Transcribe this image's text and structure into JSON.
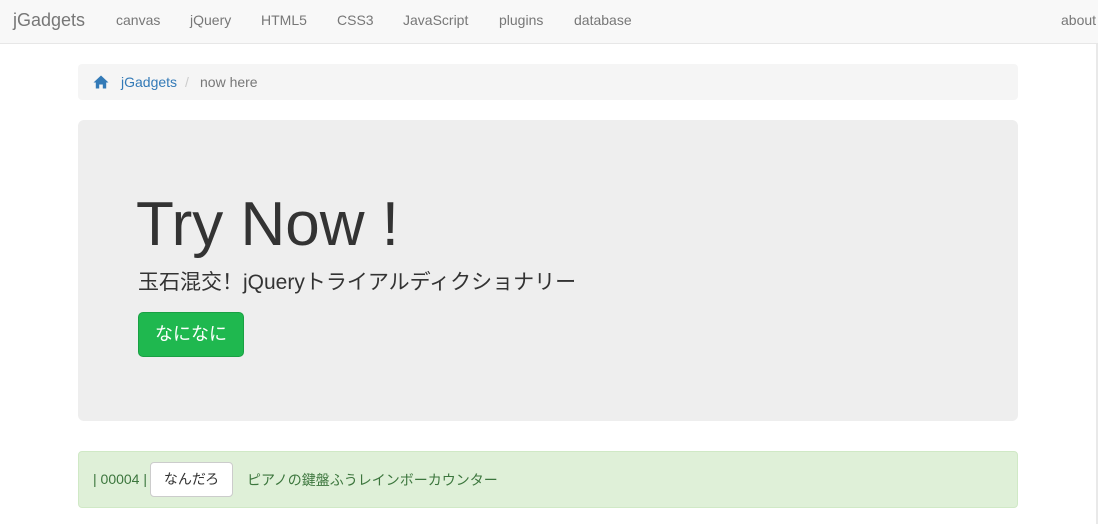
{
  "navbar": {
    "brand": "jGadgets",
    "items": [
      {
        "label": "canvas"
      },
      {
        "label": "jQuery"
      },
      {
        "label": "HTML5"
      },
      {
        "label": "CSS3"
      },
      {
        "label": "JavaScript"
      },
      {
        "label": "plugins"
      },
      {
        "label": "database"
      }
    ],
    "about": "about"
  },
  "breadcrumb": {
    "home_icon": "home-icon",
    "link": "jGadgets",
    "separator": "/",
    "current": "now here"
  },
  "hero": {
    "title": "Try Now !",
    "subtitle": "玉石混交！jQueryトライアルディクショナリー",
    "button_label": "なになに"
  },
  "counter": {
    "prefix": "| 00004 |",
    "button_label": "なんだろ",
    "link_text": "ピアノの鍵盤ふうレインボーカウンター"
  },
  "colors": {
    "link": "#337ab7",
    "success_button": "#1fb84f",
    "alert_bg": "#dff0d8",
    "alert_text": "#3c763d"
  }
}
